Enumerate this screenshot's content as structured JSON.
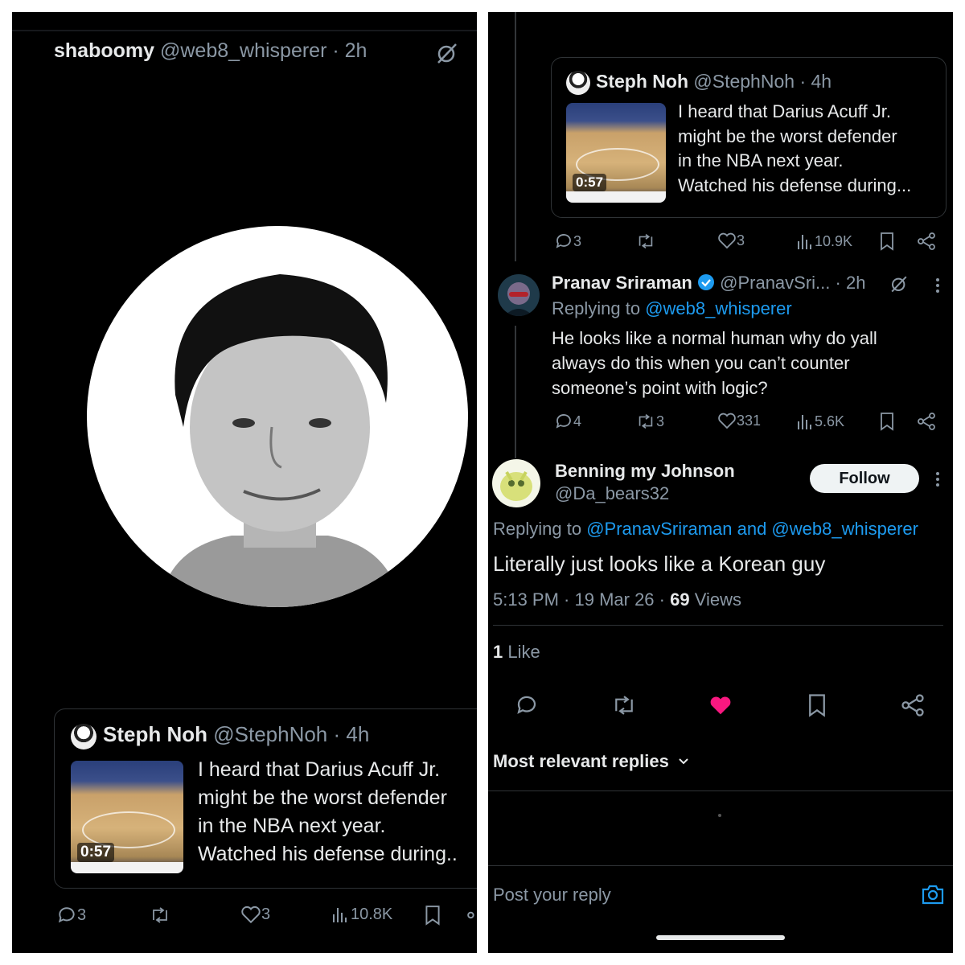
{
  "left": {
    "header": {
      "name": "shaboomy",
      "handle": "@web8_whisperer",
      "time": "· 2h"
    },
    "quote": {
      "name": "Steph Noh",
      "handle": "@StephNoh",
      "time": "· 4h",
      "text_lines": [
        "I heard that Darius Acuff Jr.",
        "might be the worst defender",
        "in the NBA next year.",
        "Watched his defense during.."
      ],
      "video_duration": "0:57"
    },
    "actions": {
      "replies": "3",
      "likes": "3",
      "views": "10.8K"
    }
  },
  "right": {
    "quote": {
      "name": "Steph Noh",
      "handle": "@StephNoh",
      "time": "· 4h",
      "text_lines": [
        "I heard that Darius Acuff Jr.",
        "might be the worst defender",
        "in the NBA next year.",
        "Watched his defense during..."
      ],
      "video_duration": "0:57"
    },
    "quote_actions": {
      "replies": "3",
      "likes": "3",
      "views": "10.9K"
    },
    "reply": {
      "name": "Pranav Sriraman",
      "handle": "@PranavSri...",
      "time": "· 2h",
      "replying_prefix": "Replying to",
      "replying_to": "@web8_whisperer",
      "text_lines": [
        "He looks like a normal human why do yall",
        "always do this when you can’t counter",
        "someone’s point with logic?"
      ],
      "replies": "4",
      "reposts": "3",
      "likes": "331",
      "views": "5.6K"
    },
    "main": {
      "name": "Benning my Johnson",
      "handle": "@Da_bears32",
      "follow_label": "Follow",
      "replying_prefix": "Replying to",
      "replying_to": "@PranavSriraman and @web8_whisperer",
      "text": "Literally just looks like a Korean guy",
      "timestamp": "5:13 PM · 19 Mar 26 ·",
      "views_count": "69",
      "views_label": "Views",
      "likes_count": "1",
      "likes_label": "Like"
    },
    "sort_label": "Most relevant replies",
    "reply_placeholder": "Post your reply",
    "colors": {
      "accent": "#1d9bf0",
      "like_active": "#f91880"
    }
  }
}
